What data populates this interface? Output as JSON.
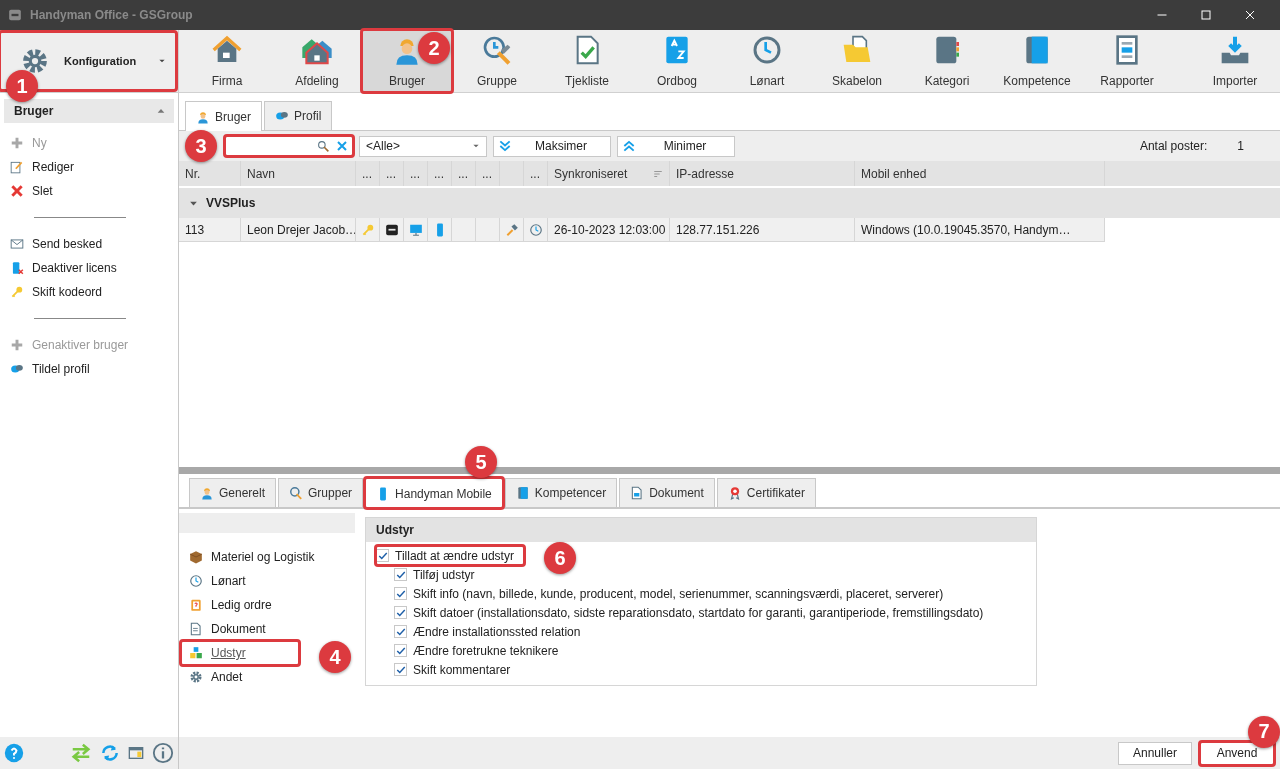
{
  "window": {
    "title": "Handyman Office - GSGroup"
  },
  "module_button": {
    "label": "Konfiguration",
    "callout": "1"
  },
  "ribbon": [
    {
      "label": "Firma",
      "selected": false
    },
    {
      "label": "Afdeling",
      "selected": false
    },
    {
      "label": "Bruger",
      "selected": true,
      "callout": "2"
    },
    {
      "label": "Gruppe",
      "selected": false
    },
    {
      "label": "Tjekliste",
      "selected": false
    },
    {
      "label": "Ordbog",
      "selected": false
    },
    {
      "label": "Lønart",
      "selected": false
    },
    {
      "label": "Skabelon",
      "selected": false
    },
    {
      "label": "Kategori",
      "selected": false
    },
    {
      "label": "Kompetence",
      "selected": false
    },
    {
      "label": "Rapporter",
      "selected": false
    },
    {
      "label": "Importer",
      "selected": false
    }
  ],
  "sidebar": {
    "title": "Bruger",
    "groups": [
      {
        "items": [
          {
            "label": "Ny",
            "disabled": true
          },
          {
            "label": "Rediger",
            "disabled": false
          },
          {
            "label": "Slet",
            "disabled": false
          }
        ]
      },
      {
        "items": [
          {
            "label": "Send besked",
            "disabled": false
          },
          {
            "label": "Deaktiver licens",
            "disabled": false
          },
          {
            "label": "Skift kodeord",
            "disabled": false
          }
        ]
      },
      {
        "items": [
          {
            "label": "Genaktiver bruger",
            "disabled": true
          },
          {
            "label": "Tildel profil",
            "disabled": false
          }
        ]
      }
    ]
  },
  "upper_tabs": [
    {
      "label": "Bruger",
      "selected": true
    },
    {
      "label": "Profil",
      "selected": false
    }
  ],
  "toolbar": {
    "search": {
      "callout": "3"
    },
    "filter": {
      "value": "<Alle>"
    },
    "expand_button": "Maksimer",
    "collapse_button": "Minimer",
    "count_label": "Antal poster:",
    "count": "1"
  },
  "table": {
    "columns": [
      {
        "label": "Nr.",
        "kind": "text"
      },
      {
        "label": "Navn",
        "kind": "text"
      },
      {
        "label": "...",
        "kind": "icon"
      },
      {
        "label": "...",
        "kind": "icon"
      },
      {
        "label": "...",
        "kind": "icon"
      },
      {
        "label": "...",
        "kind": "icon"
      },
      {
        "label": "...",
        "kind": "icon"
      },
      {
        "label": "...",
        "kind": "icon"
      },
      {
        "kind": "icon"
      },
      {
        "label": "...",
        "kind": "icon"
      },
      {
        "label": "Synkroniseret",
        "kind": "text"
      },
      {
        "label": "IP-adresse",
        "kind": "text"
      },
      {
        "label": "Mobil enhed",
        "kind": "text"
      }
    ],
    "groups": [
      {
        "name": "VVSPlus",
        "expanded": true,
        "rows": [
          {
            "cells": [
              "113",
              "Leon  Drejer Jacob…",
              "26-10-2023 12:03:00",
              "128.77.151.226",
              "Windows (10.0.19045.3570, Handym…"
            ]
          }
        ]
      }
    ]
  },
  "lower_tabs": [
    {
      "label": "Generelt",
      "selected": false
    },
    {
      "label": "Grupper",
      "selected": false
    },
    {
      "label": "Handyman Mobile",
      "selected": true,
      "callout": "5"
    },
    {
      "label": "Kompetencer",
      "selected": false
    },
    {
      "label": "Dokument",
      "selected": false
    },
    {
      "label": "Certifikater",
      "selected": false
    }
  ],
  "nav": [
    {
      "label": "Materiel og Logistik",
      "selected": false
    },
    {
      "label": "Lønart",
      "selected": false
    },
    {
      "label": "Ledig ordre",
      "selected": false
    },
    {
      "label": "Dokument",
      "selected": false
    },
    {
      "label": "Udstyr",
      "selected": true,
      "callout": "4"
    },
    {
      "label": "Andet",
      "selected": false
    }
  ],
  "panel": {
    "title": "Udstyr",
    "options": [
      {
        "label": "Tilladt at ændre udstyr",
        "checked": true,
        "callout": "6",
        "children": [
          {
            "label": "Tilføj udstyr",
            "checked": true
          },
          {
            "label": "Skift info (navn, billede, kunde, producent, model, serienummer, scanningsværdi, placeret, serverer)",
            "checked": true
          },
          {
            "label": "Skift datoer (installationsdato, sidste reparationsdato, startdato for garanti, garantiperiode, fremstillingsdato)",
            "checked": true
          },
          {
            "label": "Ændre installationssted relation",
            "checked": true
          },
          {
            "label": "Ændre foretrukne teknikere",
            "checked": true
          },
          {
            "label": "Skift kommentarer",
            "checked": true
          }
        ]
      }
    ]
  },
  "buttons": [
    {
      "label": "Annuller"
    },
    {
      "label": "Anvend",
      "callout": "7"
    }
  ]
}
